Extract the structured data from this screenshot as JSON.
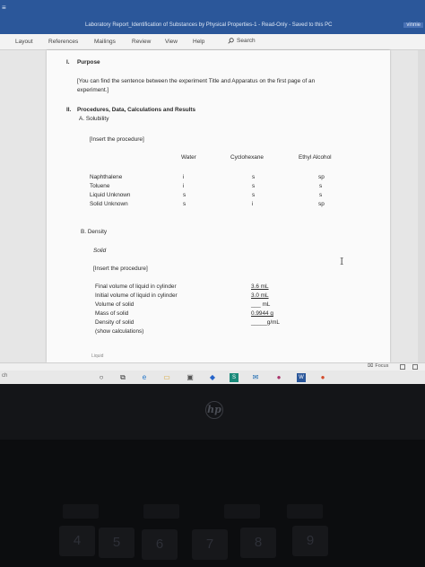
{
  "window": {
    "title": "Laboratory Report_Identification of Substances by Physical Properties-1  -  Read-Only  -  Saved to this PC",
    "user": "vinnie"
  },
  "ribbon": {
    "tabs": [
      "Layout",
      "References",
      "Mailings",
      "Review",
      "View",
      "Help"
    ],
    "search_label": "Search"
  },
  "document": {
    "section1_number": "I.",
    "section1_title": "Purpose",
    "purpose_text_line1": "[You can find the sentence between the experiment Title and Apparatus on the first page of an",
    "purpose_text_line2": "experiment.]",
    "section2_number": "II.",
    "section2_title": "Procedures, Data, Calculations and Results",
    "subA_label": "A.  Solubility",
    "insert_procedure_a": "[Insert the procedure]",
    "solubility_table": {
      "headers": [
        "Water",
        "Cyclohexane",
        "Ethyl Alcohol"
      ],
      "rows": [
        {
          "substance": "Naphthalene",
          "values": [
            "i",
            "s",
            "sp"
          ]
        },
        {
          "substance": "Toluene",
          "values": [
            "i",
            "s",
            "s"
          ]
        },
        {
          "substance": "Liquid Unknown",
          "values": [
            "s",
            "s",
            "s"
          ]
        },
        {
          "substance": "Solid Unknown",
          "values": [
            "s",
            "i",
            "sp"
          ]
        }
      ]
    },
    "subB_label": "B.  Density",
    "solid_label": "Solid",
    "insert_procedure_b": "[Insert the procedure]",
    "density_table": [
      {
        "label": "Final volume of liquid in cylinder",
        "value": "3.6 mL"
      },
      {
        "label": "Initial volume of liquid in cylinder",
        "value": "3.0 mL"
      },
      {
        "label": "Volume of solid",
        "value": "___ mL"
      },
      {
        "label": "Mass of solid",
        "value": "0.9944 g"
      },
      {
        "label": "Density of solid",
        "value": "_____g/mL"
      },
      {
        "label": "(show calculations)",
        "value": ""
      }
    ],
    "cutoff_text": "Liquid"
  },
  "statusbar": {
    "focus_label": "Focus"
  },
  "taskbar": {
    "search_placeholder": "ch"
  },
  "laptop": {
    "brand": "hp",
    "number_keys": [
      "4",
      "5",
      "6",
      "7",
      "8",
      "9"
    ]
  }
}
